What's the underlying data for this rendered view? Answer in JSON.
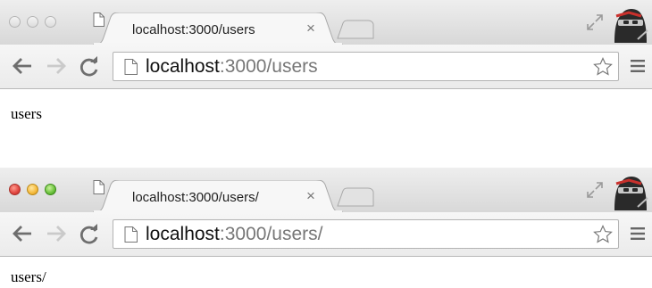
{
  "windows": [
    {
      "tab": {
        "title": "localhost:3000/users",
        "close_glyph": "×"
      },
      "omnibox": {
        "host": "localhost",
        "rest": ":3000/users"
      },
      "page": {
        "text": "users"
      },
      "traffic_lights": "inactive"
    },
    {
      "tab": {
        "title": "localhost:3000/users/",
        "close_glyph": "×"
      },
      "omnibox": {
        "host": "localhost",
        "rest": ":3000/users/"
      },
      "page": {
        "text": "users/"
      },
      "traffic_lights": "active"
    }
  ],
  "icons": {
    "back": "back-arrow-icon",
    "forward": "forward-arrow-icon",
    "reload": "reload-icon",
    "page": "page-icon",
    "star": "star-icon",
    "menu": "menu-icon",
    "fullscreen": "fullscreen-icon",
    "profile": "ninja-avatar-icon"
  },
  "colors": {
    "close_light": "#e0443e",
    "minimize_light": "#f5b93a",
    "zoom_light": "#69c13b",
    "url_host": "#111111",
    "url_rest": "#777777"
  }
}
